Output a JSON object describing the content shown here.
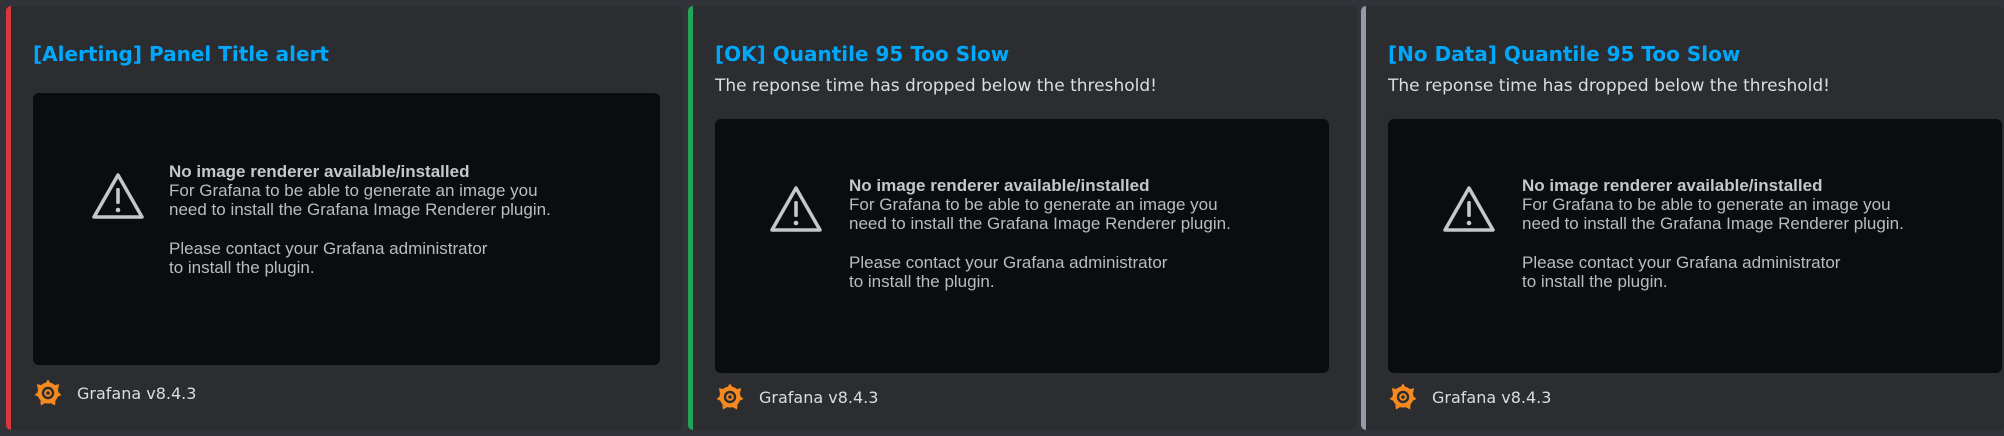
{
  "colors": {
    "background": "#313338",
    "embed_background": "#2b2d31",
    "title_link": "#00a8fc",
    "image_background": "#0b0c0e",
    "grafana_orange": "#f68a1f"
  },
  "embeds": [
    {
      "status_color": "#da373c",
      "title": "[Alerting] Panel Title alert",
      "description": "",
      "image": {
        "heading": "No image renderer available/installed",
        "line1": "For Grafana to be able to generate an image you",
        "line2": "need to install the Grafana Image Renderer plugin.",
        "line3": "Please contact your Grafana administrator",
        "line4": "to install the plugin.",
        "icon": "warning-triangle-icon"
      },
      "footer": {
        "text": "Grafana v8.4.3",
        "icon": "grafana-logo-icon"
      }
    },
    {
      "status_color": "#23a559",
      "title": "[OK] Quantile 95 Too Slow",
      "description": "The reponse time has dropped below the threshold!",
      "image": {
        "heading": "No image renderer available/installed",
        "line1": "For Grafana to be able to generate an image you",
        "line2": "need to install the Grafana Image Renderer plugin.",
        "line3": "Please contact your Grafana administrator",
        "line4": "to install the plugin.",
        "icon": "warning-triangle-icon"
      },
      "footer": {
        "text": "Grafana v8.4.3",
        "icon": "grafana-logo-icon"
      }
    },
    {
      "status_color": "#949ba4",
      "title": "[No Data] Quantile 95 Too Slow",
      "description": "The reponse time has dropped below the threshold!",
      "image": {
        "heading": "No image renderer available/installed",
        "line1": "For Grafana to be able to generate an image you",
        "line2": "need to install the Grafana Image Renderer plugin.",
        "line3": "Please contact your Grafana administrator",
        "line4": "to install the plugin.",
        "icon": "warning-triangle-icon"
      },
      "footer": {
        "text": "Grafana v8.4.3",
        "icon": "grafana-logo-icon"
      }
    }
  ]
}
